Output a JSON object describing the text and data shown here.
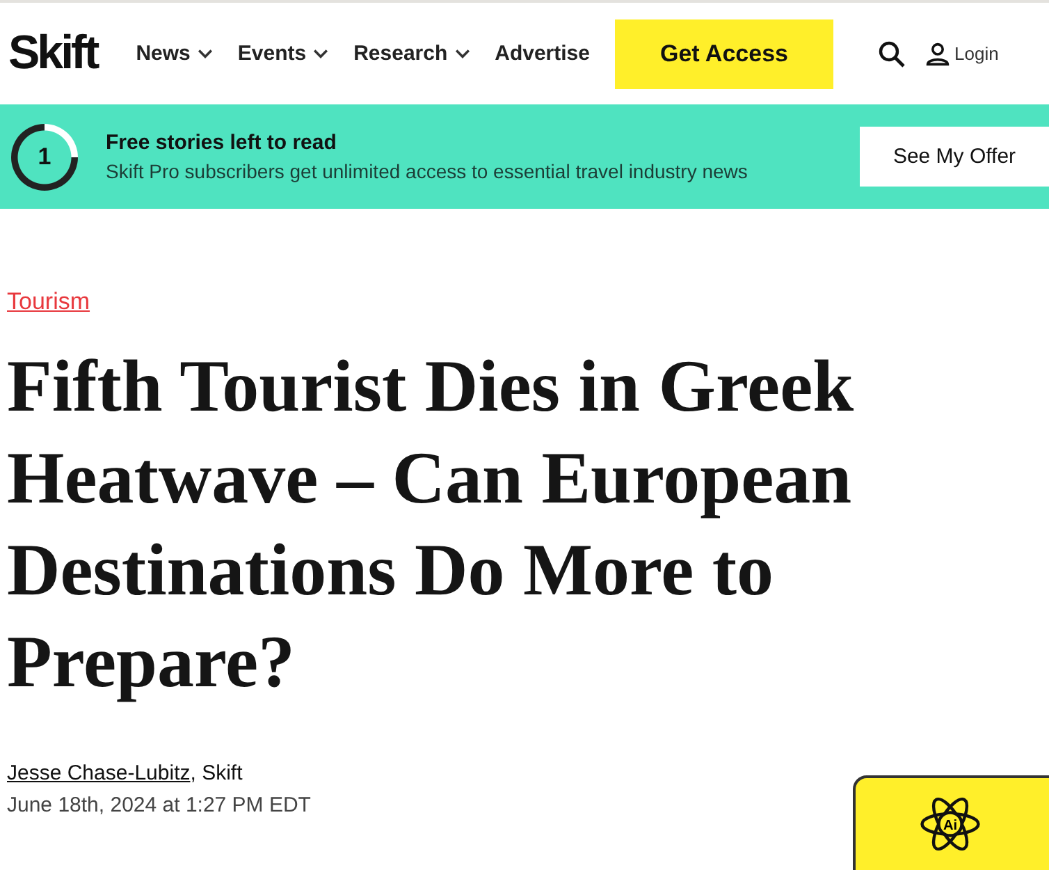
{
  "header": {
    "logo": "Skift",
    "nav": [
      {
        "label": "News",
        "dropdown": true
      },
      {
        "label": "Events",
        "dropdown": true
      },
      {
        "label": "Research",
        "dropdown": true
      },
      {
        "label": "Advertise",
        "dropdown": false
      }
    ],
    "cta": "Get Access",
    "login": "Login"
  },
  "banner": {
    "count": "1",
    "title": "Free stories left to read",
    "text": "Skift Pro subscribers get unlimited access to essential travel industry news",
    "button": "See My Offer"
  },
  "article": {
    "category": "Tourism",
    "title": "Fifth Tourist Dies in Greek Heatwave – Can European Destinations Do More to Prepare?",
    "author": "Jesse Chase-Lubitz",
    "source": ", Skift",
    "date": "June 18th, 2024 at 1:27 PM EDT"
  },
  "ask_widget": {
    "icon_label": "Ai"
  }
}
